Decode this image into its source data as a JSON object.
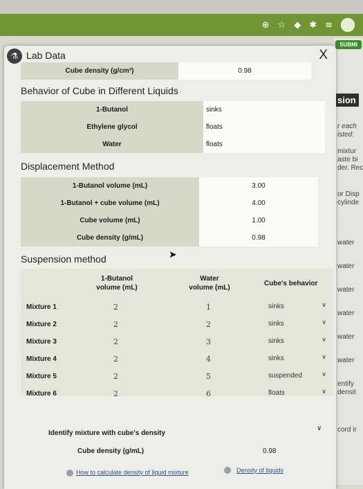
{
  "browser": {
    "icons": [
      "add-circle-icon",
      "star-icon",
      "shield-icon",
      "puzzle-icon",
      "playlist-icon",
      "profile-avatar-icon"
    ]
  },
  "submit_label": "SUBMI",
  "side_text": {
    "sion": "sion",
    "lines": [
      "r each",
      "isted:",
      "mixtur",
      "aste bi",
      "der. Rec",
      "or Disp",
      "cylinde",
      "water",
      "water",
      "water",
      "water",
      "water",
      "water",
      "entify",
      "densit",
      "cord ir"
    ]
  },
  "panel": {
    "title": "Lab Data",
    "close": "X"
  },
  "cube_density_row": {
    "label": "Cube density (g/cm³)",
    "value": "0.98"
  },
  "behavior": {
    "title": "Behavior of Cube in Different Liquids",
    "rows": [
      {
        "liquid": "1-Butanol",
        "result": "sinks"
      },
      {
        "liquid": "Ethylene glycol",
        "result": "floats"
      },
      {
        "liquid": "Water",
        "result": "floats"
      }
    ]
  },
  "displacement": {
    "title": "Displacement Method",
    "rows": [
      {
        "label": "1-Butanol volume (mL)",
        "value": "3.00"
      },
      {
        "label": "1-Butanol + cube volume (mL)",
        "value": "4.00"
      },
      {
        "label": "Cube volume (mL)",
        "value": "1.00"
      },
      {
        "label": "Cube density (g/mL)",
        "value": "0.98"
      }
    ]
  },
  "suspension": {
    "title": "Suspension method",
    "headers": {
      "butanol_1": "1-Butanol",
      "butanol_2": "volume (mL)",
      "water_1": "Water",
      "water_2": "volume (mL)",
      "behavior": "Cube's behavior"
    },
    "rows": [
      {
        "name": "Mixture 1",
        "butanol": "2",
        "water": "1",
        "behavior": "sinks"
      },
      {
        "name": "Mixture 2",
        "butanol": "2",
        "water": "2",
        "behavior": "sinks"
      },
      {
        "name": "Mixture 3",
        "butanol": "2",
        "water": "3",
        "behavior": "sinks"
      },
      {
        "name": "Mixture 4",
        "butanol": "2",
        "water": "4",
        "behavior": "sinks"
      },
      {
        "name": "Mixture 5",
        "butanol": "2",
        "water": "5",
        "behavior": "suspended"
      },
      {
        "name": "Mixture 6",
        "butanol": "2",
        "water": "6",
        "behavior": "floats"
      }
    ]
  },
  "identify": {
    "label": "Identify mixture with cube's density",
    "density_label": "Cube density (g/mL)",
    "density_value": "0.98"
  },
  "links": {
    "calc": "How to calculate density of liquid mixture",
    "densities": "Density of liquids"
  }
}
